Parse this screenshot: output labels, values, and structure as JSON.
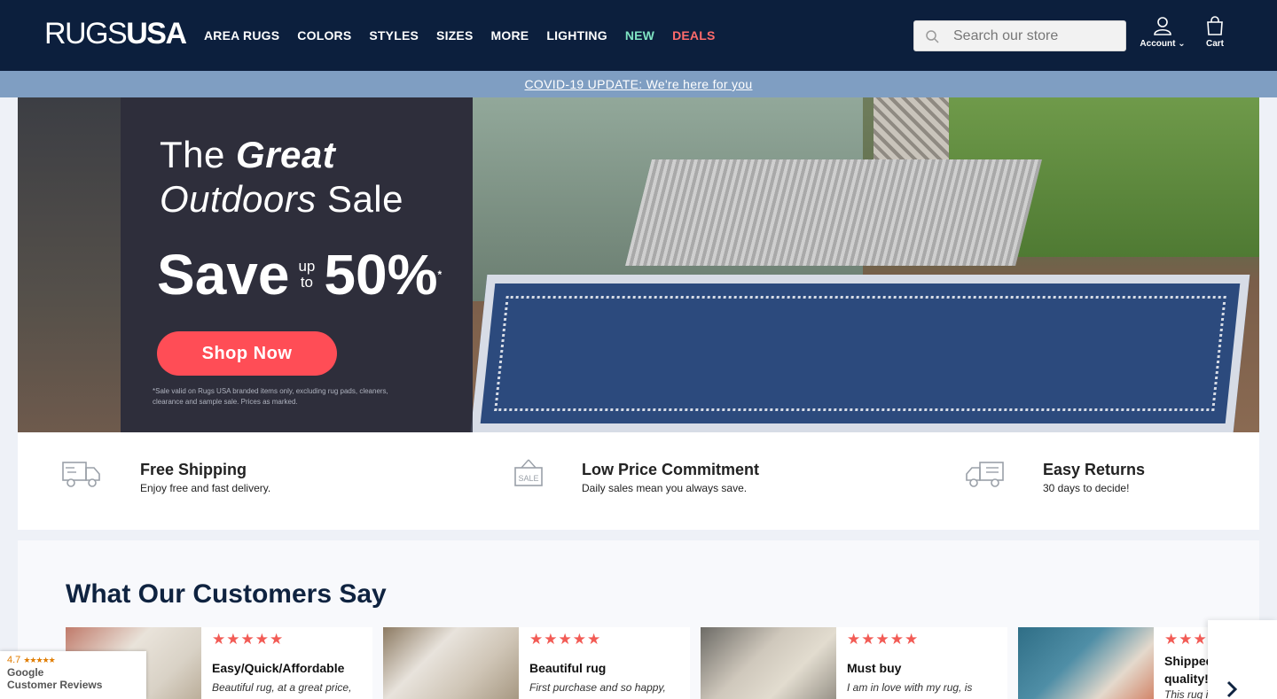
{
  "header": {
    "logo": {
      "part1": "RUGS",
      "part2": "USA"
    },
    "nav": [
      {
        "label": "AREA RUGS"
      },
      {
        "label": "COLORS"
      },
      {
        "label": "STYLES"
      },
      {
        "label": "SIZES"
      },
      {
        "label": "MORE"
      },
      {
        "label": "LIGHTING"
      },
      {
        "label": "NEW"
      },
      {
        "label": "DEALS"
      }
    ],
    "search_placeholder": "Search our store",
    "account_label": "Account",
    "cart_label": "Cart"
  },
  "covid_link": "COVID-19 UPDATE: We're here for you",
  "hero": {
    "line1_a": "The",
    "line1_b": "Great",
    "line2_a": "Outdoors",
    "line2_b": "Sale",
    "save": "Save",
    "up": "up",
    "to": "to",
    "percent": "50%",
    "asterisk": "*",
    "button": "Shop Now",
    "fineprint": "*Sale valid on Rugs USA branded items only, excluding rug pads, cleaners, clearance and sample sale. Prices as marked."
  },
  "features": [
    {
      "icon": "truck-icon",
      "title": "Free Shipping",
      "desc": "Enjoy free and fast delivery."
    },
    {
      "icon": "sale-tag-icon",
      "title": "Low Price Commitment",
      "desc": "Daily sales mean you always save."
    },
    {
      "icon": "return-truck-icon",
      "title": "Easy Returns",
      "desc": "30 days to decide!"
    }
  ],
  "reviews": {
    "heading": "What Our Customers Say",
    "cards": [
      {
        "stars": "★★★★★",
        "title": "Easy/Quick/Affordable",
        "text": "Beautiful rug, at a great price,"
      },
      {
        "stars": "★★★★★",
        "title": "Beautiful rug",
        "text": "First purchase and so happy,"
      },
      {
        "stars": "★★★★★",
        "title": "Must buy",
        "text": "I am in love with my rug, is"
      },
      {
        "stars": "★★★★★",
        "title": "Shipped quality!",
        "text": "This rug i"
      }
    ]
  },
  "google_badge": {
    "rating": "4.7",
    "stars": "★★★★★",
    "brand": "Google",
    "label": "Customer Reviews"
  },
  "colors": {
    "header_bg": "#0c1f3d",
    "accent": "#ff4d56",
    "new": "#7fe4c3",
    "covid_bar": "#7f9ec2"
  }
}
